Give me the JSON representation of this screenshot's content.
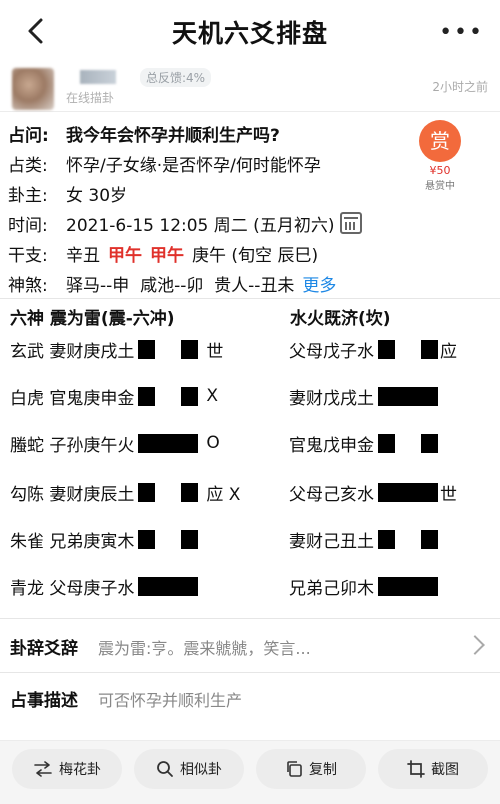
{
  "header": {
    "title": "天机六爻排盘"
  },
  "user": {
    "tag": "在线描卦",
    "feedback": "总反馈:4%",
    "time": "2小时之前"
  },
  "info": {
    "question": {
      "label": "占问:",
      "value": "我今年会怀孕并顺利生产吗?"
    },
    "category": {
      "label": "占类:",
      "value": "怀孕/子女缘·是否怀孕/何时能怀孕"
    },
    "owner": {
      "label": "卦主:",
      "value": "女 30岁"
    },
    "time": {
      "label": "时间:",
      "value": "2021-6-15 12:05 周二 (五月初六)"
    },
    "ganzhi": {
      "label": "干支:",
      "p1": "辛丑",
      "p2": "甲午",
      "p3": "甲午",
      "p4": "庚午 (旬空 辰巳)"
    },
    "shensha": {
      "label": "神煞:",
      "value": "驿马--申  咸池--卯  贵人--丑未",
      "more": "更多"
    }
  },
  "reward": {
    "badge": "赏",
    "amount": "¥50",
    "status": "悬赏中"
  },
  "gua": {
    "left_title": "六神  震为雷(震-六冲)",
    "right_title": "水火既济(坎)",
    "left": [
      {
        "label": "玄武 妻财庚戌土",
        "mark": "世"
      },
      {
        "label": "白虎 官鬼庚申金",
        "mark": "X"
      },
      {
        "label": "螣蛇 子孙庚午火",
        "mark": "O"
      },
      {
        "label": "勾陈 妻财庚辰土",
        "mark": "应 X"
      },
      {
        "label": "朱雀 兄弟庚寅木",
        "mark": ""
      },
      {
        "label": "青龙 父母庚子水",
        "mark": ""
      }
    ],
    "right": [
      {
        "label": "父母戊子水",
        "mark": "应"
      },
      {
        "label": "妻财戊戌土",
        "mark": ""
      },
      {
        "label": "官鬼戊申金",
        "mark": ""
      },
      {
        "label": "父母己亥水",
        "mark": "世"
      },
      {
        "label": "妻财己丑土",
        "mark": ""
      },
      {
        "label": "兄弟己卯木",
        "mark": ""
      }
    ]
  },
  "sections": {
    "guaci": {
      "label": "卦辞爻辞",
      "value": "震为雷:亨。震来虩虩，笑言..."
    },
    "desc": {
      "label": "占事描述",
      "value": "可否怀孕并顺利生产"
    }
  },
  "actions": [
    {
      "label": "梅花卦",
      "icon": "swap-icon"
    },
    {
      "label": "相似卦",
      "icon": "search-icon"
    },
    {
      "label": "复制",
      "icon": "copy-icon"
    },
    {
      "label": "截图",
      "icon": "crop-icon"
    }
  ]
}
